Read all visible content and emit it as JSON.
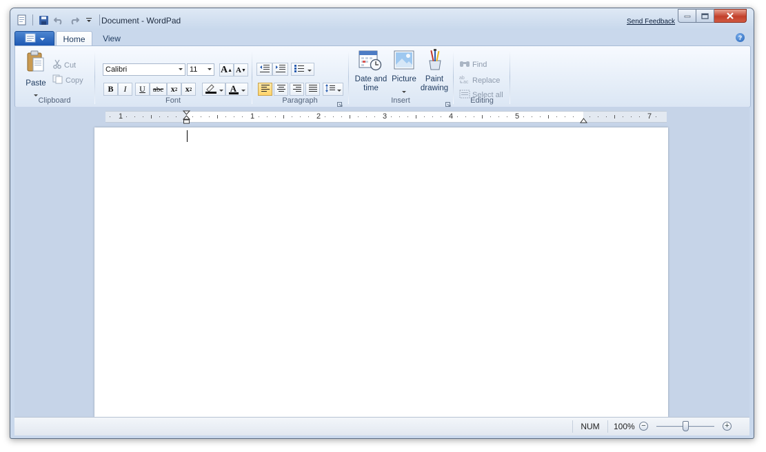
{
  "window": {
    "title": "Document - WordPad",
    "feedback_link": "Send Feedback"
  },
  "quick_access": {
    "icons": [
      "app-document-icon",
      "save-icon",
      "undo-icon",
      "redo-icon",
      "customize-dropdown-icon"
    ]
  },
  "tabs": [
    {
      "label": "Home",
      "selected": true
    },
    {
      "label": "View",
      "selected": false
    }
  ],
  "ribbon": {
    "clipboard": {
      "label": "Clipboard",
      "paste": "Paste",
      "cut": "Cut",
      "copy": "Copy"
    },
    "font": {
      "label": "Font",
      "family": "Calibri",
      "size": "11",
      "bold": "B",
      "italic": "I",
      "underline": "U",
      "strike": "abc",
      "grow": "A",
      "shrink": "A",
      "subscript": "x",
      "superscript": "x",
      "sub_mark": "2",
      "sup_mark": "2",
      "font_color_glyph": "A"
    },
    "paragraph": {
      "label": "Paragraph"
    },
    "insert": {
      "label": "Insert",
      "datetime_line1": "Date and",
      "datetime_line2": "time",
      "picture": "Picture",
      "paint_line1": "Paint",
      "paint_line2": "drawing"
    },
    "editing": {
      "label": "Editing",
      "find": "Find",
      "replace": "Replace",
      "select_all": "Select all"
    }
  },
  "ruler": {
    "numbers": [
      "1",
      "1",
      "2",
      "3",
      "4",
      "5",
      "7"
    ]
  },
  "statusbar": {
    "num_lock": "NUM",
    "zoom": "100%",
    "zoom_out": "−",
    "zoom_in": "+",
    "zoom_level": 0.5
  },
  "colors": {
    "accent": "#1d58b3",
    "highlight": "#ffd36a",
    "close": "#c2402b"
  }
}
